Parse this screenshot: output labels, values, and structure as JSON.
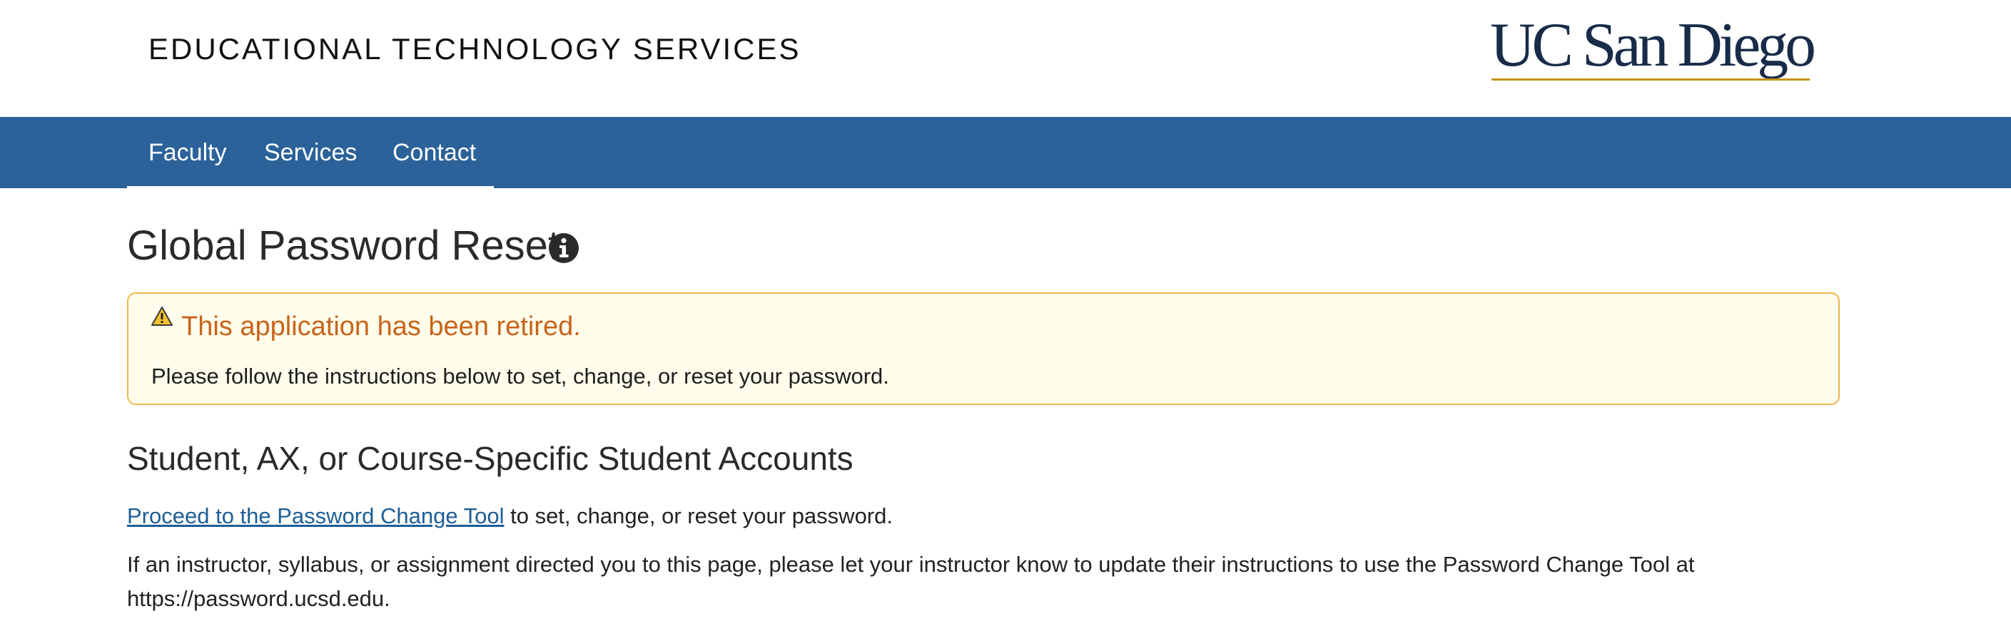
{
  "header": {
    "site_title": "EDUCATIONAL TECHNOLOGY SERVICES",
    "logo_text": "UC San Diego",
    "logo_icon": "uc-san-diego-logo"
  },
  "nav": {
    "items": [
      {
        "label": "Faculty"
      },
      {
        "label": "Services"
      },
      {
        "label": "Contact"
      }
    ]
  },
  "main": {
    "title": "Global Password Reset",
    "title_icon": "info-circle-icon",
    "alert": {
      "icon": "warning-triangle-icon",
      "heading": "This application has been retired.",
      "text": "Please follow the instructions below to set, change, or reset your password."
    },
    "section": {
      "heading": "Student, AX, or Course-Specific Student Accounts",
      "link_text": "Proceed to the Password Change Tool",
      "link_suffix": " to set, change, or reset your password.",
      "paragraph_line1": "If an instructor, syllabus, or assignment directed you to this page, please let your instructor know to update their instructions to use the Password Change Tool at",
      "paragraph_line2": "https://password.ucsd.edu."
    }
  },
  "colors": {
    "navbar": "#2b6299",
    "alert_background": "#fffdeb",
    "alert_border": "#f0b64e",
    "alert_heading": "#c8641a",
    "link": "#1d5e96",
    "logo_navy": "#182b49",
    "logo_gold": "#c69214"
  }
}
